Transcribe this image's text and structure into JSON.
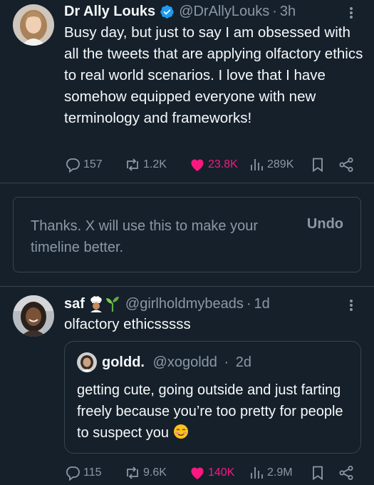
{
  "tweet1": {
    "name": "Dr Ally Louks",
    "handle": "@DrAllyLouks",
    "time": "3h",
    "text": "Busy day, but just to say I am obsessed with all the tweets that are applying olfactory ethics to real world scenarios. I love that I have somehow equipped everyone with new terminology and frameworks!",
    "replies": "157",
    "reposts": "1.2K",
    "likes": "23.8K",
    "views": "289K"
  },
  "notice": {
    "text": "Thanks. X will use this to make your timeline better.",
    "undo": "Undo"
  },
  "tweet2": {
    "name": "saf",
    "handle": "@girlholdmybeads",
    "time": "1d",
    "text": "olfactory ethicsssss",
    "replies": "115",
    "reposts": "9.6K",
    "likes": "140K",
    "views": "2.9M"
  },
  "quote": {
    "name": "goldd.",
    "handle": "@xogoldd",
    "time": "2d",
    "text": "getting cute, going outside and just farting freely because you’re too pretty for people to suspect you"
  },
  "separator": "·",
  "colors": {
    "background": "#15202b",
    "text": "#f7f9f9",
    "muted": "#8b98a5",
    "like": "#f91880",
    "verified": "#1d9bf0",
    "border": "#38444d"
  },
  "icons": [
    "reply-icon",
    "repost-icon",
    "heart-icon",
    "views-icon",
    "bookmark-icon",
    "share-icon",
    "verified-badge-icon",
    "more-icon",
    "chef-emoji-icon",
    "seedling-emoji-icon",
    "smiling-face-emoji-icon"
  ]
}
